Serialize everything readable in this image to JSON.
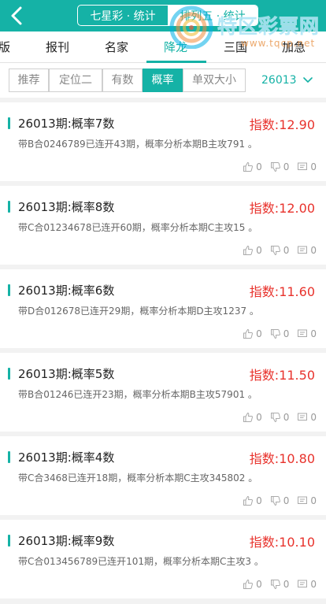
{
  "header": {
    "tabs": [
      {
        "label": "七星彩 · 统计",
        "active": false
      },
      {
        "label": "排列五 · 统计",
        "active": true
      }
    ]
  },
  "watermark": {
    "title": "特区彩票网",
    "url": "www.tqcp.net"
  },
  "categories": [
    {
      "label": "版",
      "active": false
    },
    {
      "label": "报刊",
      "active": false
    },
    {
      "label": "名家",
      "active": false
    },
    {
      "label": "降龙",
      "active": true
    },
    {
      "label": "三国",
      "active": false
    },
    {
      "label": "加急",
      "active": false
    }
  ],
  "filters": [
    {
      "label": "推荐",
      "active": false
    },
    {
      "label": "定位二",
      "active": false
    },
    {
      "label": "有数",
      "active": false
    },
    {
      "label": "概率",
      "active": true
    },
    {
      "label": "单双大小",
      "active": false
    }
  ],
  "issue_select": {
    "value": "26013"
  },
  "cards": [
    {
      "title": "26013期:概率7数",
      "index": "指数:12.90",
      "desc": "带B合0246789已连开43期，概率分析本期B主攻791 。",
      "likes": "0",
      "dislikes": "0",
      "comments": "0"
    },
    {
      "title": "26013期:概率8数",
      "index": "指数:12.00",
      "desc": "带C合01234678已连开60期，概率分析本期C主攻15 。",
      "likes": "0",
      "dislikes": "0",
      "comments": "0"
    },
    {
      "title": "26013期:概率6数",
      "index": "指数:11.60",
      "desc": "带D合012678已连开29期，概率分析本期D主攻1237 。",
      "likes": "0",
      "dislikes": "0",
      "comments": "0"
    },
    {
      "title": "26013期:概率5数",
      "index": "指数:11.50",
      "desc": "带B合01246已连开23期，概率分析本期B主攻57901 。",
      "likes": "0",
      "dislikes": "0",
      "comments": "0"
    },
    {
      "title": "26013期:概率4数",
      "index": "指数:10.80",
      "desc": "带C合3468已连开18期，概率分析本期C主攻345802 。",
      "likes": "0",
      "dislikes": "0",
      "comments": "0"
    },
    {
      "title": "26013期:概率9数",
      "index": "指数:10.10",
      "desc": "带C合013456789已连开101期，概率分析本期C主攻3 。",
      "likes": "0",
      "dislikes": "0",
      "comments": "0"
    }
  ],
  "colors": {
    "accent": "#15b2a6",
    "index_red": "#e8322c"
  }
}
